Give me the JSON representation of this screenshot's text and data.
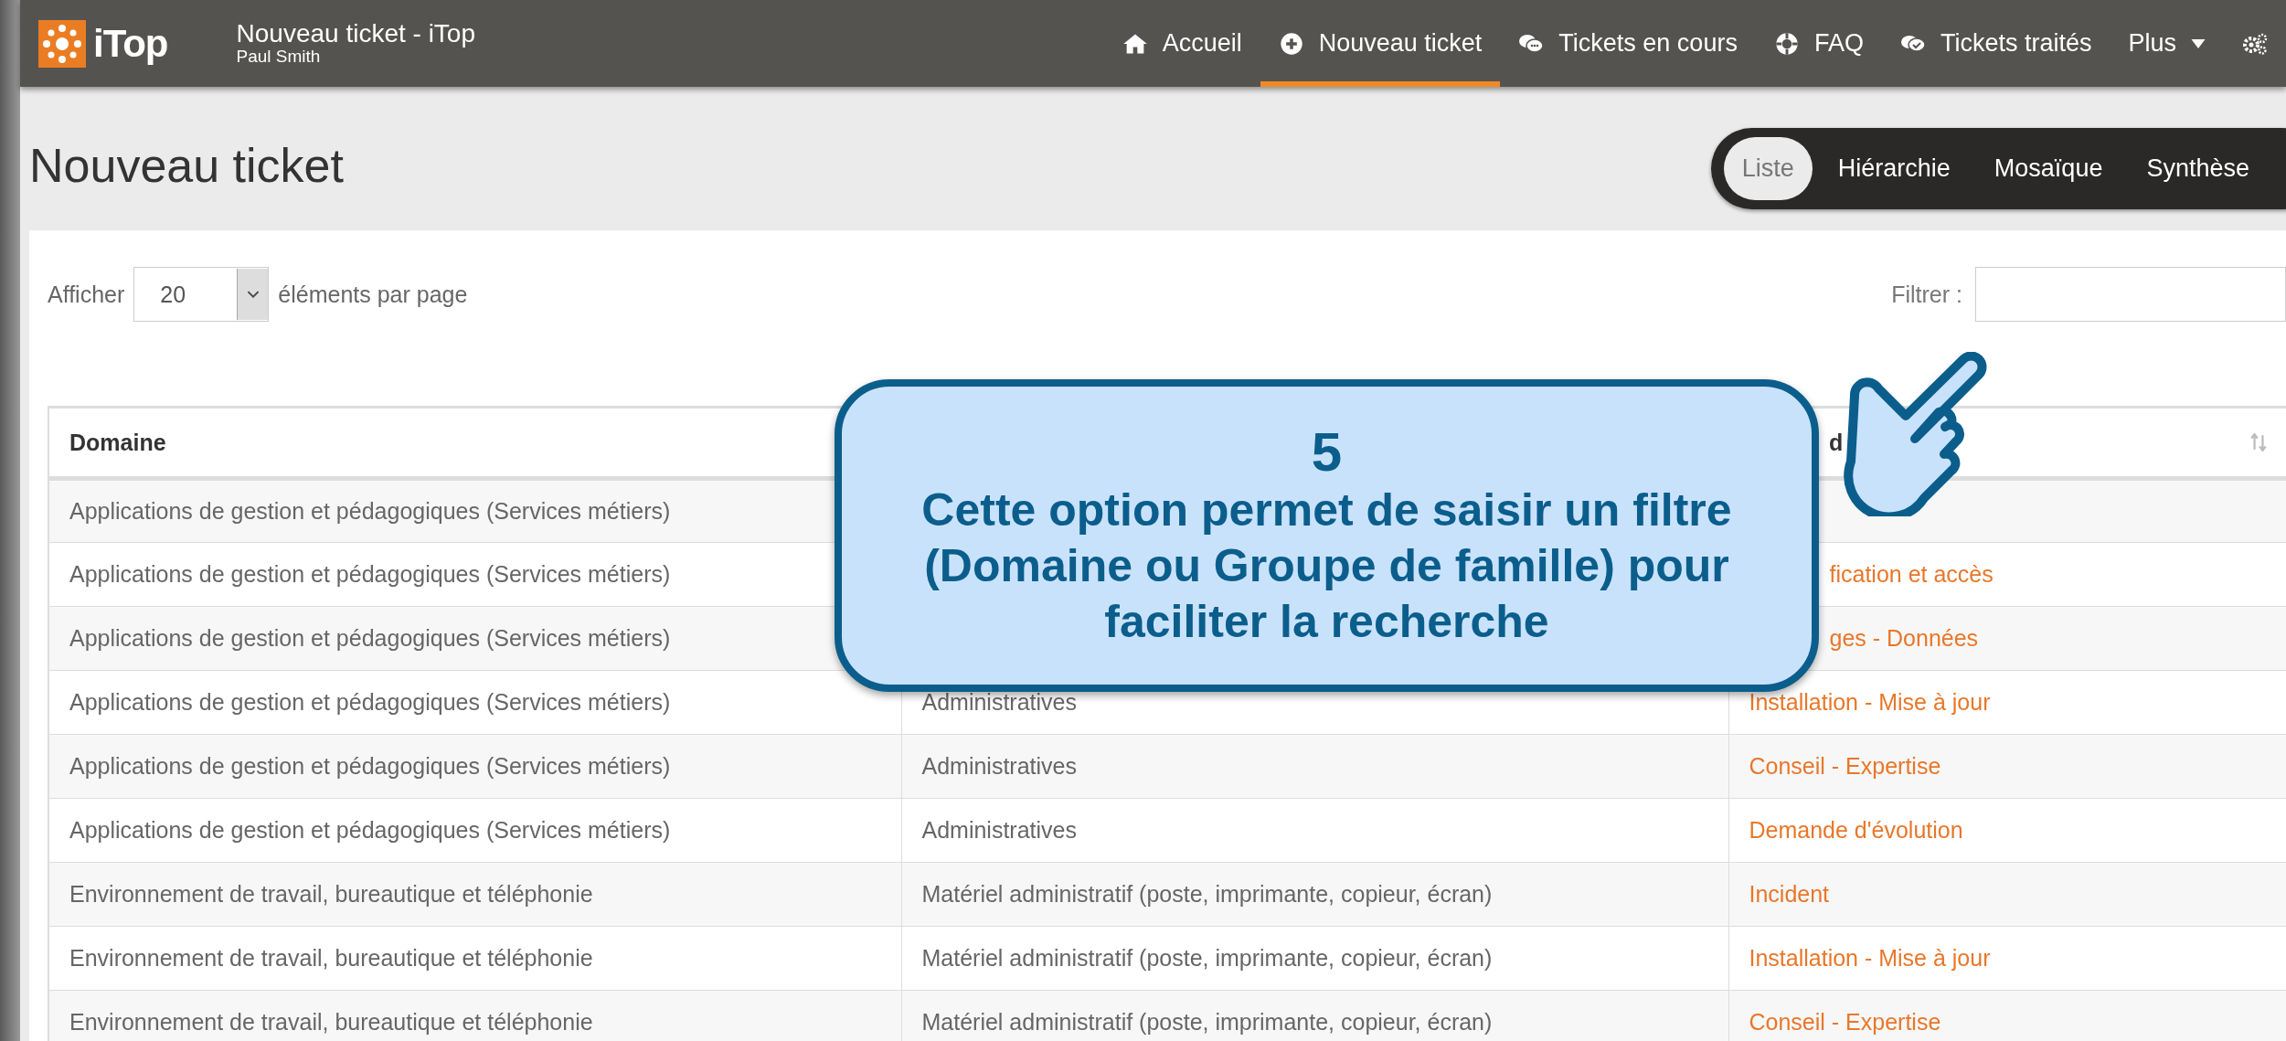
{
  "header": {
    "logo": "iTop",
    "title": "Nouveau ticket - iTop",
    "user": "Paul Smith"
  },
  "nav": [
    {
      "kind": "home",
      "label": "Accueil",
      "selected": false
    },
    {
      "kind": "new",
      "label": "Nouveau ticket",
      "selected": true
    },
    {
      "kind": "chat",
      "label": "Tickets en cours",
      "selected": false
    },
    {
      "kind": "help",
      "label": "FAQ",
      "selected": false
    },
    {
      "kind": "done",
      "label": "Tickets traités",
      "selected": false
    },
    {
      "kind": "more",
      "label": "Plus",
      "selected": false
    },
    {
      "kind": "settings",
      "selected": false
    }
  ],
  "page_title": "Nouveau ticket",
  "views": [
    {
      "label": "Liste",
      "selected": true
    },
    {
      "label": "Hiérarchie",
      "selected": false
    },
    {
      "label": "Mosaïque",
      "selected": false
    },
    {
      "label": "Synthèse",
      "selected": false
    }
  ],
  "length_menu": {
    "prefix": "Afficher",
    "value": "20",
    "suffix": "éléments par page"
  },
  "filter": {
    "label": "Filtrer :"
  },
  "table": {
    "header": {
      "column_1": "Domaine",
      "column_3": "d",
      "column_3_cut": true
    },
    "rows": [
      {
        "column_1": "Applications de gestion et pédagogiques (Services métiers)"
      },
      {
        "column_1": "Applications de gestion et pédagogiques (Services métiers)",
        "column_3": "fication et accès",
        "column_3_cut": true
      },
      {
        "column_1": "Applications de gestion et pédagogiques (Services métiers)",
        "column_3": "ges - Données",
        "column_3_cut": true
      },
      {
        "column_1": "Applications de gestion et pédagogiques (Services métiers)",
        "column_2": "Administratives",
        "column_3": "Installation - Mise à jour"
      },
      {
        "column_1": "Applications de gestion et pédagogiques (Services métiers)",
        "column_2": "Administratives",
        "column_3": "Conseil - Expertise"
      },
      {
        "column_1": "Applications de gestion et pédagogiques (Services métiers)",
        "column_2": "Administratives",
        "column_3": "Demande d'évolution"
      },
      {
        "column_1": "Environnement de travail, bureautique et téléphonie",
        "column_2": "Matériel administratif (poste, imprimante, copieur, écran)",
        "column_3": "Incident"
      },
      {
        "column_1": "Environnement de travail, bureautique et téléphonie",
        "column_2": "Matériel administratif (poste, imprimante, copieur, écran)",
        "column_3": "Installation - Mise à jour"
      },
      {
        "column_1": "Environnement de travail, bureautique et téléphonie",
        "column_2": "Matériel administratif (poste, imprimante, copieur, écran)",
        "column_3": "Conseil - Expertise"
      }
    ]
  },
  "callout": {
    "number": "5",
    "text": "Cette option permet de saisir un filtre (Domaine ou Groupe de famille)  pour faciliter la recherche"
  }
}
